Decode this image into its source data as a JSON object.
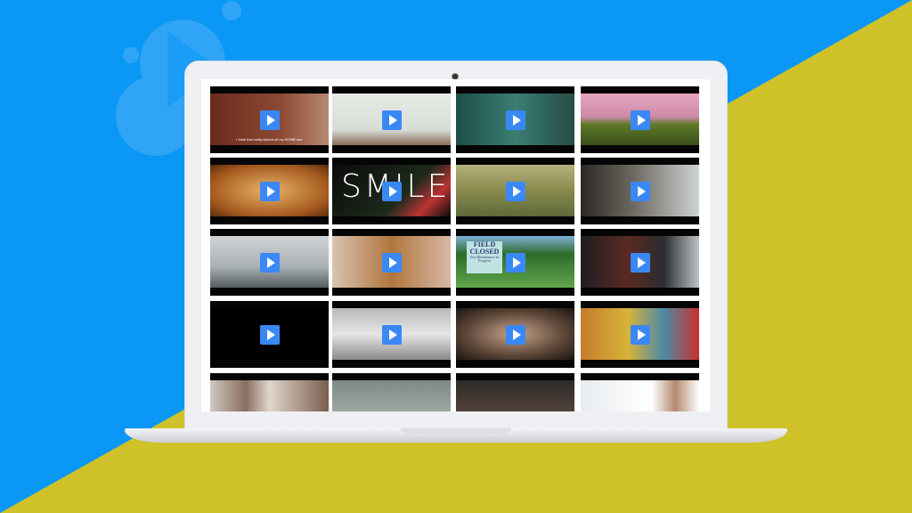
{
  "colors": {
    "background_blue": "#0a97f6",
    "background_yellow": "#cfc229",
    "play_button": "#3a88f5"
  },
  "background_icon": "cloud-play-icon",
  "thumbnails": [
    {
      "bg": "linear-gradient(90deg,#6b2a1e,#8d4a34 60%,#b58870)",
      "caption": "I think that really kicked off my BOMB tour"
    },
    {
      "bg": "linear-gradient(#e6ebe6,#d8ddd6 70%,#8a6d5b)"
    },
    {
      "bg": "linear-gradient(90deg,#1d4e48,#3b7e73 50%,#264c45)"
    },
    {
      "bg": "linear-gradient(#e7a7bf,#cc8aa8 45%,#5f7a2a 60%,#3b4e1c)"
    },
    {
      "bg": "radial-gradient(#e8b46a,#a55a1e 70%,#5b2c0d)"
    },
    {
      "bg": "linear-gradient(135deg,#0b0b0b,#1d2a1b 60%,#b33 80%,#0b0b0b)",
      "text": "SMILE"
    },
    {
      "bg": "linear-gradient(#b4b07a,#8a8a4c 50%,#5d6a3b)"
    },
    {
      "bg": "linear-gradient(90deg,#2b2724,#6e6a62 45%,#cfd3d4)"
    },
    {
      "bg": "linear-gradient(#cfd3d6,#a9b0b3 60%,#555d5f)"
    },
    {
      "bg": "linear-gradient(90deg,#d9c3b1,#b1763e 50%,#d7b8a6)"
    },
    {
      "bg": "linear-gradient(#7fb0d8,#2e6b2a 35%,#5fa74b)",
      "sign": {
        "title": "FIELD CLOSED",
        "sub": "Turf Maintenance In Progress"
      }
    },
    {
      "bg": "linear-gradient(90deg,#1e1e22,#5a2a22 40%,#2b2c30 70%,#bfc3c8)"
    },
    {
      "bg": "#000"
    },
    {
      "bg": "linear-gradient(#b8b8b8,#e6e6e6 50%,#8a8a8a)"
    },
    {
      "bg": "radial-gradient(#c7a38a,#5a4537 60%,#1c1512)"
    },
    {
      "bg": "linear-gradient(90deg,#c57b2b,#d8b33a 40%,#4d8aa6 70%,#c9302c)"
    }
  ],
  "partial_row": [
    {
      "bg": "linear-gradient(90deg,#cfc8c0,#8a6e5f 30%,#e0d6cc 50%,#7a5d4c)"
    },
    {
      "bg": "linear-gradient(#7c8a86,#b3bab4)"
    },
    {
      "bg": "linear-gradient(#2c2a28,#6b5344)"
    },
    {
      "bg": "linear-gradient(90deg,#e8ecef,#fff 60%,#b38a6f 80%,#fff)"
    }
  ]
}
